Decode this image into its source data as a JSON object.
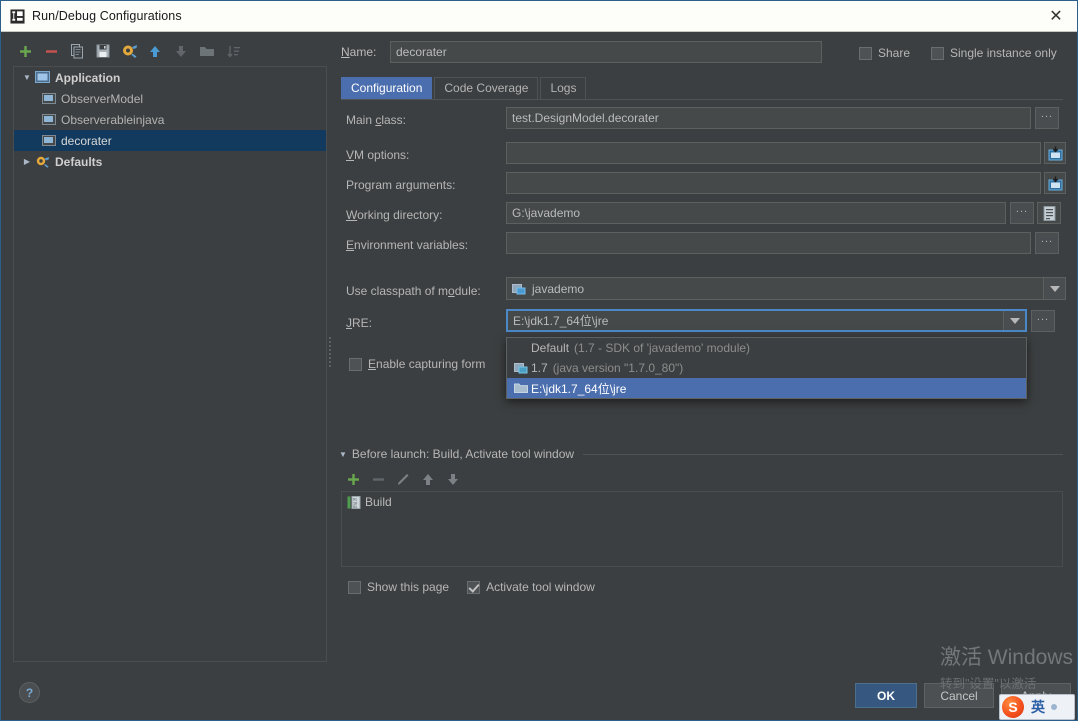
{
  "window": {
    "title": "Run/Debug Configurations",
    "close_label": "✕",
    "icon": "idea-logo-icon"
  },
  "left_panel": {
    "toolbar": [
      {
        "name": "add-configuration-button",
        "glyph": "+",
        "color": "#6aa84f",
        "enabled": true
      },
      {
        "name": "remove-configuration-button",
        "glyph": "−",
        "color": "#c75450",
        "enabled": true
      },
      {
        "name": "copy-configuration-button",
        "glyph": "copy-icon",
        "color": "#a9b7c6",
        "enabled": true
      },
      {
        "name": "save-configuration-button",
        "glyph": "save-icon",
        "color": "#b0b0b0",
        "enabled": true
      },
      {
        "name": "edit-defaults-button",
        "glyph": "wrench-icon",
        "color": "#e3a93c",
        "enabled": true
      },
      {
        "name": "move-up-button",
        "glyph": "arrow-up-icon",
        "color": "#4a9ad4",
        "enabled": true
      },
      {
        "name": "move-down-button",
        "glyph": "arrow-down-icon",
        "color": "#6a6f71",
        "enabled": false
      },
      {
        "name": "create-folder-button",
        "glyph": "folder-icon",
        "color": "#7b8184",
        "enabled": false
      },
      {
        "name": "sort-configurations-button",
        "glyph": "sort-icon",
        "color": "#6a6f71",
        "enabled": false
      }
    ],
    "tree": [
      {
        "label": "Application",
        "type": "group",
        "depth": 0,
        "expanded": true,
        "selected": false,
        "icon": "application-icon"
      },
      {
        "label": "ObserverModel",
        "type": "config",
        "depth": 1,
        "selected": false,
        "icon": "run-config-icon"
      },
      {
        "label": "Observerableinjava",
        "type": "config",
        "depth": 1,
        "selected": false,
        "icon": "run-config-icon"
      },
      {
        "label": "decorater",
        "type": "config",
        "depth": 1,
        "selected": true,
        "icon": "run-config-icon"
      },
      {
        "label": "Defaults",
        "type": "group",
        "depth": 0,
        "expanded": false,
        "selected": false,
        "icon": "defaults-icon"
      }
    ]
  },
  "header": {
    "name_label": "Name:",
    "name_value": "decorater",
    "share_label": "Share",
    "share_checked": false,
    "single_instance_label": "Single instance only",
    "single_instance_checked": false
  },
  "tabs": [
    {
      "label": "Configuration",
      "active": true
    },
    {
      "label": "Code Coverage",
      "active": false
    },
    {
      "label": "Logs",
      "active": false
    }
  ],
  "form": {
    "main_class": {
      "label": "Main class:",
      "value": "test.DesignModel.decorater",
      "browse": "...",
      "browse_icon": "ellipsis-icon"
    },
    "vm_options": {
      "label": "VM options:",
      "value": "",
      "expand_icon": "expand-editor-icon"
    },
    "program_arguments": {
      "label": "Program arguments:",
      "value": "",
      "expand_icon": "expand-editor-icon"
    },
    "working_directory": {
      "label": "Working directory:",
      "value": "G:\\javademo",
      "browse": "...",
      "macro_icon": "insert-macro-icon"
    },
    "environment_variables": {
      "label": "Environment variables:",
      "value": "",
      "browse": "..."
    },
    "use_classpath": {
      "label": "Use classpath of module:",
      "value": "javademo",
      "icon": "module-icon"
    },
    "jre": {
      "label": "JRE:",
      "value": "E:\\jdk1.7_64位\\jre",
      "browse": "..."
    },
    "enable_capturing": {
      "label": "Enable capturing form",
      "checked": false
    }
  },
  "jre_dropdown": {
    "open": true,
    "items": [
      {
        "text": "Default",
        "detail": "(1.7 - SDK of 'javademo' module)",
        "icon": null,
        "selected": false
      },
      {
        "text": "1.7",
        "detail": "(java version \"1.7.0_80\")",
        "icon": "sdk-icon",
        "selected": false
      },
      {
        "text": "E:\\jdk1.7_64位\\jre",
        "detail": "",
        "icon": "folder-icon",
        "selected": true
      }
    ]
  },
  "before_launch": {
    "title": "Before launch: Build, Activate tool window",
    "toolbar": [
      {
        "name": "add-task-button",
        "glyph": "+",
        "color": "#6aa84f",
        "enabled": true
      },
      {
        "name": "remove-task-button",
        "glyph": "−",
        "color": "#6a6f71",
        "enabled": false
      },
      {
        "name": "edit-task-button",
        "glyph": "pencil-icon",
        "color": "#7b8184",
        "enabled": false
      },
      {
        "name": "move-task-up-button",
        "glyph": "arrow-up-icon",
        "color": "#7b8184",
        "enabled": false
      },
      {
        "name": "move-task-down-button",
        "glyph": "arrow-down-icon",
        "color": "#7b8184",
        "enabled": false
      }
    ],
    "tasks": [
      {
        "label": "Build",
        "icon": "build-icon"
      }
    ],
    "show_this_page": {
      "label": "Show this page",
      "checked": false
    },
    "activate_tool_window": {
      "label": "Activate tool window",
      "checked": true
    }
  },
  "footer": {
    "help": "?",
    "ok": "OK",
    "cancel": "Cancel",
    "apply": "Apply"
  },
  "watermark": {
    "line1": "激活 Windows",
    "line2": "转到\"设置\"以激活"
  },
  "ime": {
    "logo": "S",
    "mode": "英"
  },
  "colors": {
    "background": "#3c3f41",
    "panel": "#45494a",
    "accent": "#4b6eaf",
    "selection": "#123a5e",
    "primary_button": "#365880",
    "border": "#5e6060"
  }
}
